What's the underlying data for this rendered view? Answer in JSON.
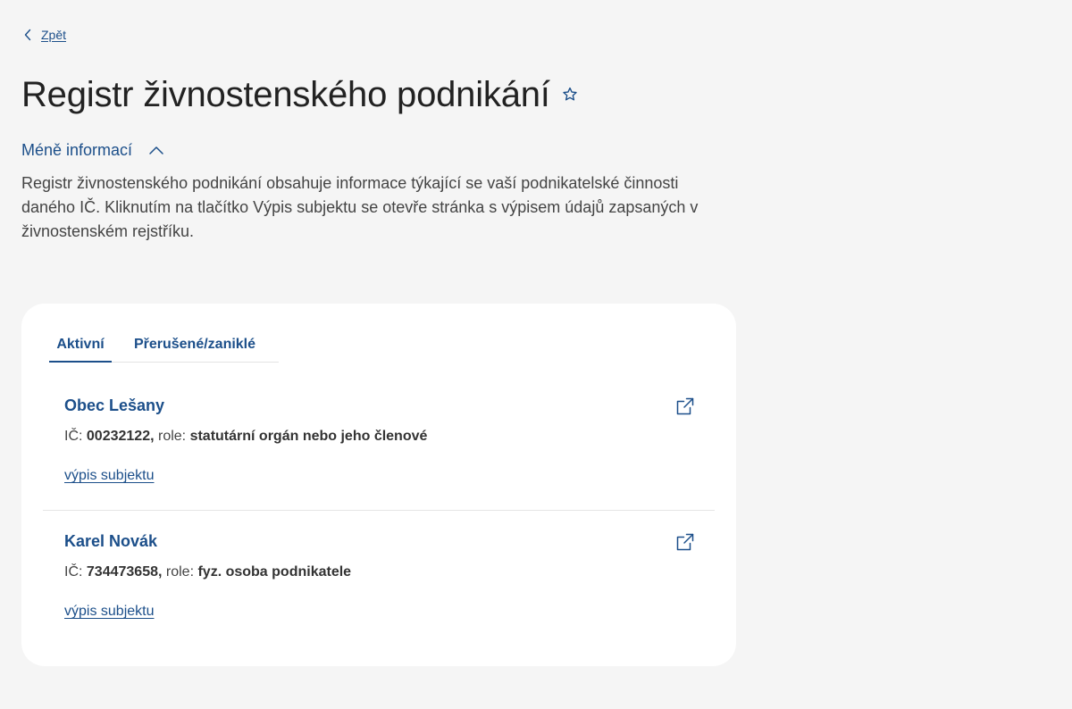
{
  "nav": {
    "back_label": "Zpět",
    "back_icon": "chevron-left-icon"
  },
  "header": {
    "title": "Registr živnostenského podnikání",
    "favorite_icon": "star-outline-icon"
  },
  "info": {
    "toggle_label": "Méně informací",
    "toggle_icon": "chevron-up-icon",
    "description": "Registr živnostenského podnikání obsahuje informace týkající se vaší podnikatelské činnosti daného IČ. Kliknutím na tlačítko Výpis subjektu se otevře stránka s výpisem údajů zapsaných v živnostenském rejstříku."
  },
  "tabs": [
    {
      "label": "Aktivní",
      "active": true
    },
    {
      "label": "Přerušené/zaniklé",
      "active": false
    }
  ],
  "entries": [
    {
      "name": "Obec Lešany",
      "ic_label": "IČ:",
      "ic_value": "00232122,",
      "role_label": "role:",
      "role_value": "statutární orgán nebo jeho členové",
      "link_label": "výpis subjektu",
      "external_icon": "external-link-icon"
    },
    {
      "name": "Karel Novák",
      "ic_label": "IČ:",
      "ic_value": "734473658,",
      "role_label": "role:",
      "role_value": "fyz. osoba podnikatele",
      "link_label": "výpis subjektu",
      "external_icon": "external-link-icon"
    }
  ],
  "colors": {
    "accent": "#1c4f8a",
    "background": "#f5f5f5",
    "card": "#ffffff",
    "text": "#333333"
  }
}
